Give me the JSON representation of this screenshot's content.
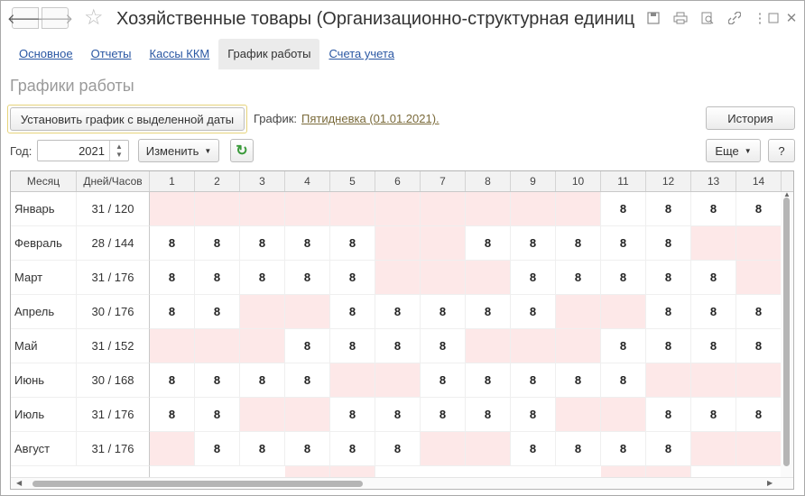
{
  "window": {
    "title": "Хозяйственные товары (Организационно-структурная единица ...",
    "icons": [
      "save-icon",
      "print-icon",
      "search-icon",
      "link-icon",
      "more-icon",
      "maximize-icon",
      "close-icon"
    ]
  },
  "tabs": [
    {
      "label": "Основное",
      "active": false
    },
    {
      "label": "Отчеты",
      "active": false
    },
    {
      "label": "Кассы ККМ",
      "active": false
    },
    {
      "label": "График работы",
      "active": true
    },
    {
      "label": "Счета учета",
      "active": false
    }
  ],
  "section_title": "Графики работы",
  "toolbar": {
    "set_schedule_label": "Установить график с выделенной даты",
    "schedule_label": "График:",
    "schedule_link": "Пятидневка (01.01.2021).",
    "history_label": "История",
    "year_label": "Год:",
    "year_value": "2021",
    "change_label": "Изменить",
    "more_label": "Еще",
    "help_label": "?"
  },
  "grid": {
    "col_month": "Месяц",
    "col_dh": "Дней/Часов",
    "days": [
      "1",
      "2",
      "3",
      "4",
      "5",
      "6",
      "7",
      "8",
      "9",
      "10",
      "11",
      "12",
      "13",
      "14"
    ],
    "rows": [
      {
        "month": "Январь",
        "dh": "31 / 120",
        "cells": [
          "",
          "",
          "",
          "",
          "",
          "",
          "",
          "",
          "",
          "",
          "8",
          "8",
          "8",
          "8"
        ]
      },
      {
        "month": "Февраль",
        "dh": "28 / 144",
        "cells": [
          "8",
          "8",
          "8",
          "8",
          "8",
          "",
          "",
          "8",
          "8",
          "8",
          "8",
          "8",
          "",
          ""
        ]
      },
      {
        "month": "Март",
        "dh": "31 / 176",
        "cells": [
          "8",
          "8",
          "8",
          "8",
          "8",
          "",
          "",
          "",
          "8",
          "8",
          "8",
          "8",
          "8",
          ""
        ]
      },
      {
        "month": "Апрель",
        "dh": "30 / 176",
        "cells": [
          "8",
          "8",
          "",
          "",
          "8",
          "8",
          "8",
          "8",
          "8",
          "",
          "",
          "8",
          "8",
          "8"
        ]
      },
      {
        "month": "Май",
        "dh": "31 / 152",
        "cells": [
          "",
          "",
          "",
          "8",
          "8",
          "8",
          "8",
          "",
          "",
          "",
          "8",
          "8",
          "8",
          "8"
        ]
      },
      {
        "month": "Июнь",
        "dh": "30 / 168",
        "cells": [
          "8",
          "8",
          "8",
          "8",
          "",
          "",
          "8",
          "8",
          "8",
          "8",
          "8",
          "",
          "",
          ""
        ]
      },
      {
        "month": "Июль",
        "dh": "31 / 176",
        "cells": [
          "8",
          "8",
          "",
          "",
          "8",
          "8",
          "8",
          "8",
          "8",
          "",
          "",
          "8",
          "8",
          "8"
        ]
      },
      {
        "month": "Август",
        "dh": "31 / 176",
        "cells": [
          "",
          "8",
          "8",
          "8",
          "8",
          "8",
          "",
          "",
          "8",
          "8",
          "8",
          "8",
          "",
          ""
        ]
      }
    ]
  },
  "colors": {
    "weekend": "#fde8e8",
    "link": "#2a57a3",
    "accent_border": "#e6d37a"
  }
}
